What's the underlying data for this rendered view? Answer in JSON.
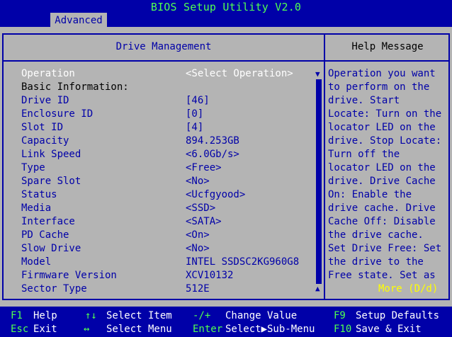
{
  "title": "BIOS Setup Utility V2.0",
  "tab": "Advanced",
  "main_header": "Drive Management",
  "help_header": "Help Message",
  "items": [
    {
      "label": "Operation",
      "value": "<Select Operation>"
    },
    {
      "label": "Basic Information:",
      "value": ""
    },
    {
      "label": "Drive ID",
      "value": "[46]"
    },
    {
      "label": "Enclosure ID",
      "value": "[0]"
    },
    {
      "label": "Slot ID",
      "value": "[4]"
    },
    {
      "label": "Capacity",
      "value": "894.253GB"
    },
    {
      "label": "Link Speed",
      "value": "<6.0Gb/s>"
    },
    {
      "label": "Type",
      "value": "<Free>"
    },
    {
      "label": "Spare Slot",
      "value": "<No>"
    },
    {
      "label": "Status",
      "value": "<Ucfgyood>"
    },
    {
      "label": "Media",
      "value": "<SSD>"
    },
    {
      "label": "Interface",
      "value": "<SATA>"
    },
    {
      "label": "PD Cache",
      "value": "<On>"
    },
    {
      "label": "Slow Drive",
      "value": "<No>"
    },
    {
      "label": "Model",
      "value": "INTEL SSDSC2KG960G8"
    },
    {
      "label": "Firmware Version",
      "value": "XCV10132"
    },
    {
      "label": "Sector Type",
      "value": "512E"
    }
  ],
  "help_lines": [
    "Operation you want",
    "to perform on the",
    "drive. Start",
    "Locate: Turn on the",
    "locator LED on the",
    "drive. Stop Locate:",
    "Turn off the",
    "locator LED on the",
    "drive. Drive Cache",
    "On: Enable the",
    "drive cache. Drive",
    "Cache Off: Disable",
    "the drive cache.",
    "Set Drive Free: Set",
    "the drive to the",
    "Free state. Set as"
  ],
  "help_more": "More (D/d)",
  "bottom": {
    "r1": [
      {
        "key": "F1",
        "desc": "Help"
      },
      {
        "key": "↑↓",
        "desc": "Select Item"
      },
      {
        "key": "-/+",
        "desc": "Change Value"
      },
      {
        "key": "F9",
        "desc": "Setup Defaults"
      }
    ],
    "r2": [
      {
        "key": "Esc",
        "desc": "Exit"
      },
      {
        "key": "↔",
        "desc": "Select Menu"
      },
      {
        "key": "Enter",
        "desc": "Select▶Sub-Menu"
      },
      {
        "key": "F10",
        "desc": "Save & Exit"
      }
    ]
  },
  "colors": {
    "blue": "#0000a8",
    "gray": "#b4b4b4",
    "green": "#50ff50",
    "yellow": "#ffff00",
    "white": "#ffffff"
  }
}
